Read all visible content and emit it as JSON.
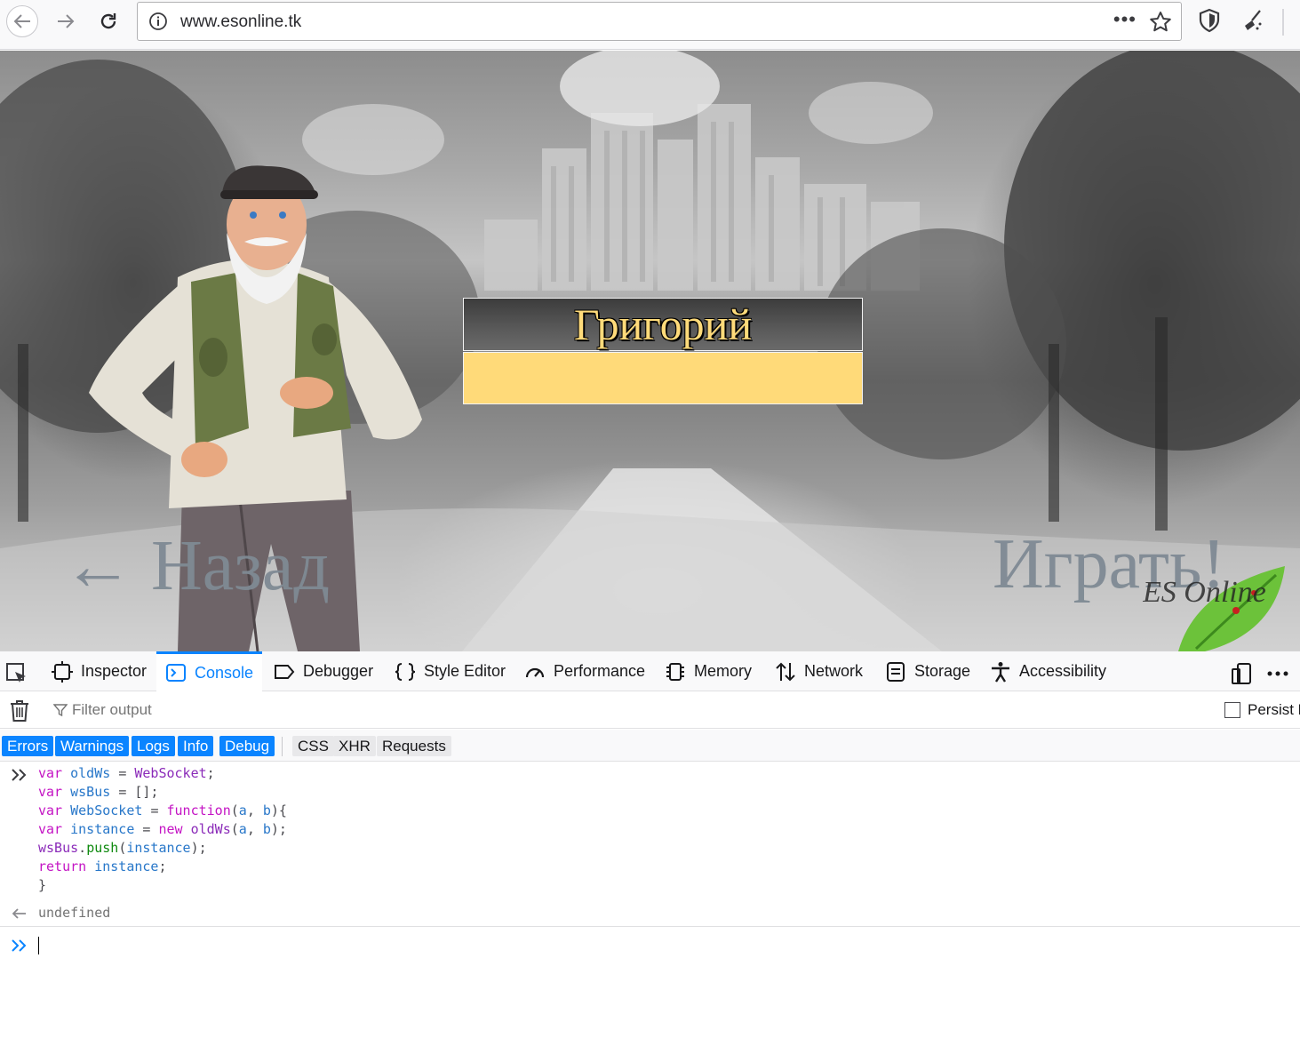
{
  "browser": {
    "url": "www.esonline.tk",
    "page_actions_label": "•••"
  },
  "game": {
    "speaker_name": "Григорий",
    "dialog_text": "",
    "back_label": "← Назад",
    "play_label": "Играть!",
    "logo_text": "ES Online"
  },
  "devtools": {
    "tabs": [
      {
        "label": "Inspector",
        "icon": "inspector-icon"
      },
      {
        "label": "Console",
        "icon": "console-icon",
        "selected": true
      },
      {
        "label": "Debugger",
        "icon": "debugger-icon"
      },
      {
        "label": "Style Editor",
        "icon": "braces-icon"
      },
      {
        "label": "Performance",
        "icon": "gauge-icon"
      },
      {
        "label": "Memory",
        "icon": "chip-icon"
      },
      {
        "label": "Network",
        "icon": "arrows-updown-icon"
      },
      {
        "label": "Storage",
        "icon": "storage-icon"
      },
      {
        "label": "Accessibility",
        "icon": "accessibility-icon"
      }
    ],
    "filter_placeholder": "Filter output",
    "persist_label": "Persist Logs",
    "levels_on": [
      "Errors",
      "Warnings",
      "Logs",
      "Info",
      "Debug"
    ],
    "levels_off": [
      "CSS",
      "XHR",
      "Requests"
    ],
    "code_lines": [
      "var oldWs = WebSocket;",
      "var wsBus = [];",
      "var WebSocket = function(a, b){",
      "var instance = new oldWs(a, b);",
      "wsBus.push(instance);",
      "return instance;",
      "}"
    ],
    "result": "undefined",
    "input_value": ""
  },
  "colors": {
    "accent": "#0a84ff",
    "name_text": "#ffdb7a",
    "dialog_bg": "#ffda79",
    "keyword": "#c414c4",
    "variable": "#2877c9"
  }
}
